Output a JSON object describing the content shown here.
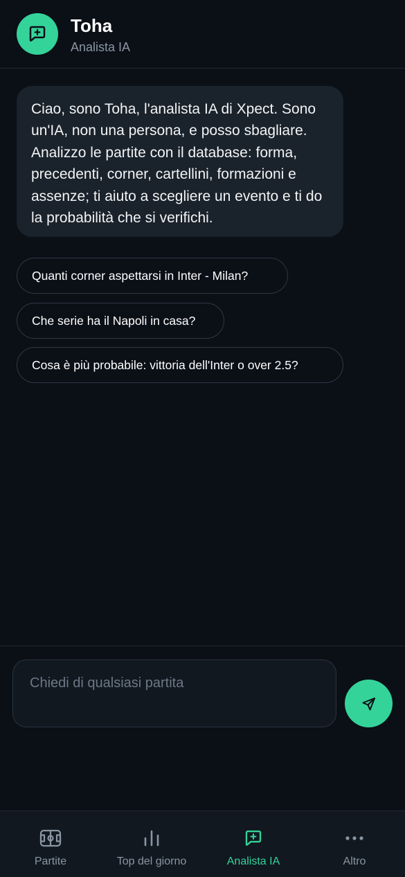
{
  "header": {
    "title": "Toha",
    "subtitle": "Analista IA",
    "avatar_icon": "chat-sparkle-icon"
  },
  "message": {
    "text": "Ciao, sono Toha, l'analista IA di Xpect. Sono un'IA, non una persona, e posso sbagliare. Analizzo le partite con il database: forma, precedenti, corner, cartellini, formazioni e assenze; ti aiuto a scegliere un evento e ti do la probabilità che si verifichi."
  },
  "suggestions": [
    "Quanti corner aspettarsi in Inter - Milan?",
    "Che serie ha il Napoli in casa?",
    "Cosa è più probabile: vittoria dell'Inter o over 2.5?"
  ],
  "composer": {
    "placeholder": "Chiedi di qualsiasi partita",
    "value": "",
    "send_icon": "send-icon"
  },
  "nav": {
    "items": [
      {
        "label": "Partite",
        "icon": "pitch-icon",
        "active": false
      },
      {
        "label": "Top del giorno",
        "icon": "bar-chart-icon",
        "active": false
      },
      {
        "label": "Analista IA",
        "icon": "chat-sparkle-icon",
        "active": true
      },
      {
        "label": "Altro",
        "icon": "more-dots-icon",
        "active": false
      }
    ]
  },
  "colors": {
    "accent": "#34d399",
    "background": "#0b0f16",
    "bubble": "#1a222b",
    "nav_background": "#111820",
    "muted_text": "#8a96a3"
  }
}
